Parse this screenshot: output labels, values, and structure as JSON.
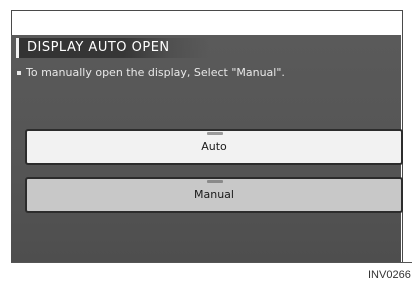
{
  "screen": {
    "title": "DISPLAY AUTO OPEN",
    "instruction": "To manually open the display, Select \"Manual\"."
  },
  "buttons": [
    {
      "label": "Auto",
      "selected": false
    },
    {
      "label": "Manual",
      "selected": true
    }
  ],
  "figure_ref": "INV0266"
}
